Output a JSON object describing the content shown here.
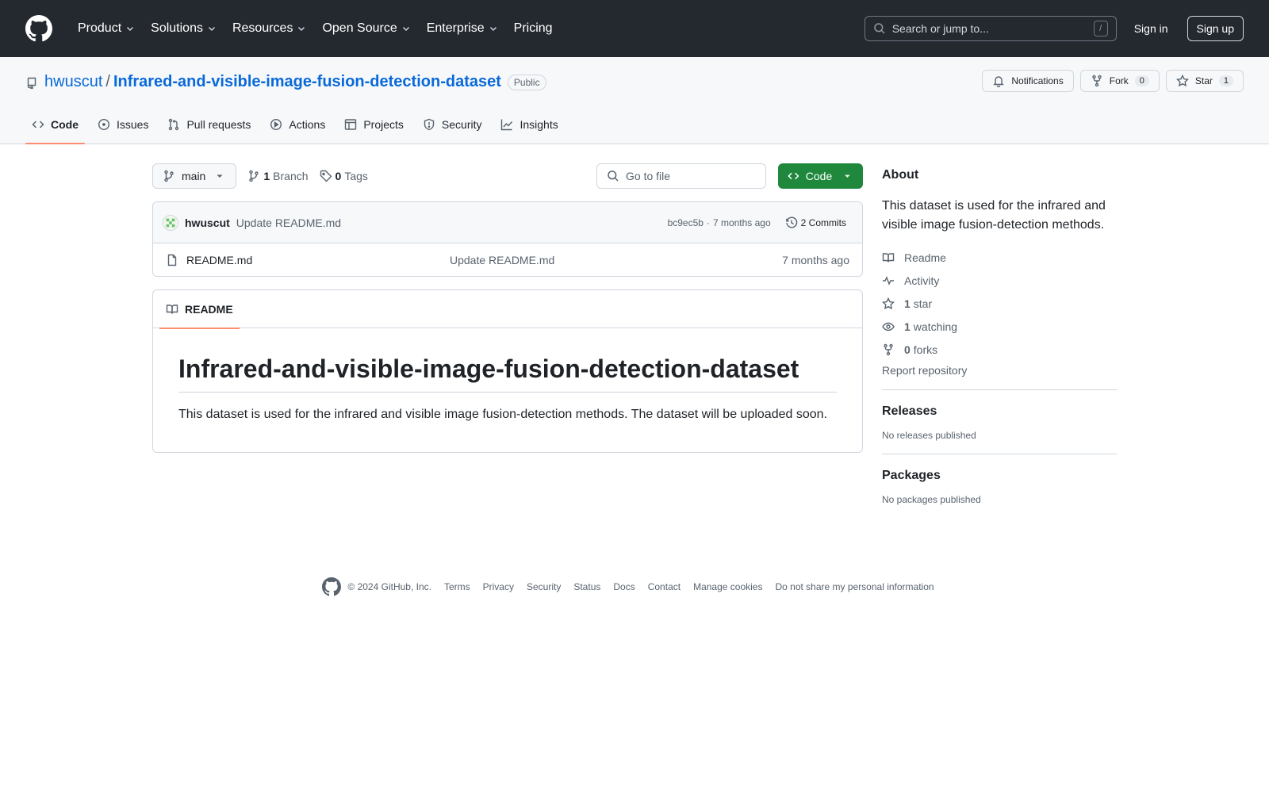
{
  "header": {
    "nav": [
      "Product",
      "Solutions",
      "Resources",
      "Open Source",
      "Enterprise",
      "Pricing"
    ],
    "search_placeholder": "Search or jump to...",
    "search_shortcut": "/",
    "sign_in": "Sign in",
    "sign_up": "Sign up"
  },
  "repo": {
    "owner": "hwuscut",
    "separator": "/",
    "name": "Infrared-and-visible-image-fusion-detection-dataset",
    "visibility": "Public",
    "notifications_label": "Notifications",
    "fork_label": "Fork",
    "fork_count": "0",
    "star_label": "Star",
    "star_count": "1"
  },
  "tabs": [
    {
      "label": "Code",
      "icon": "code-icon",
      "active": true
    },
    {
      "label": "Issues",
      "icon": "issue-icon"
    },
    {
      "label": "Pull requests",
      "icon": "pull-request-icon"
    },
    {
      "label": "Actions",
      "icon": "play-icon"
    },
    {
      "label": "Projects",
      "icon": "table-icon"
    },
    {
      "label": "Security",
      "icon": "shield-icon"
    },
    {
      "label": "Insights",
      "icon": "graph-icon"
    }
  ],
  "filebar": {
    "branch": "main",
    "branch_count": "1",
    "branch_label": "Branch",
    "tag_count": "0",
    "tag_label": "Tags",
    "goto_placeholder": "Go to file",
    "code_button": "Code"
  },
  "latest_commit": {
    "author": "hwuscut",
    "message": "Update README.md",
    "hash": "bc9ec5b",
    "separator": "·",
    "age": "7 months ago",
    "commits_label": "2 Commits"
  },
  "files": [
    {
      "name": "README.md",
      "commit": "Update README.md",
      "age": "7 months ago"
    }
  ],
  "readme": {
    "tab_label": "README",
    "heading": "Infrared-and-visible-image-fusion-detection-dataset",
    "body": "This dataset is used for the infrared and visible image fusion-detection methods. The dataset will be uploaded soon."
  },
  "sidebar": {
    "about_title": "About",
    "about_desc": "This dataset is used for the infrared and visible image fusion-detection methods.",
    "readme": "Readme",
    "activity": "Activity",
    "stars_count": "1",
    "stars_label": "star",
    "watching_count": "1",
    "watching_label": "watching",
    "forks_count": "0",
    "forks_label": "forks",
    "report": "Report repository",
    "releases_title": "Releases",
    "releases_empty": "No releases published",
    "packages_title": "Packages",
    "packages_empty": "No packages published"
  },
  "footer": {
    "copyright": "© 2024 GitHub, Inc.",
    "links": [
      "Terms",
      "Privacy",
      "Security",
      "Status",
      "Docs",
      "Contact",
      "Manage cookies",
      "Do not share my personal information"
    ]
  },
  "colors": {
    "header_bg": "#24292f",
    "link": "#0969da",
    "primary_button": "#1f883d",
    "active_tab_underline": "#fd8c73"
  }
}
